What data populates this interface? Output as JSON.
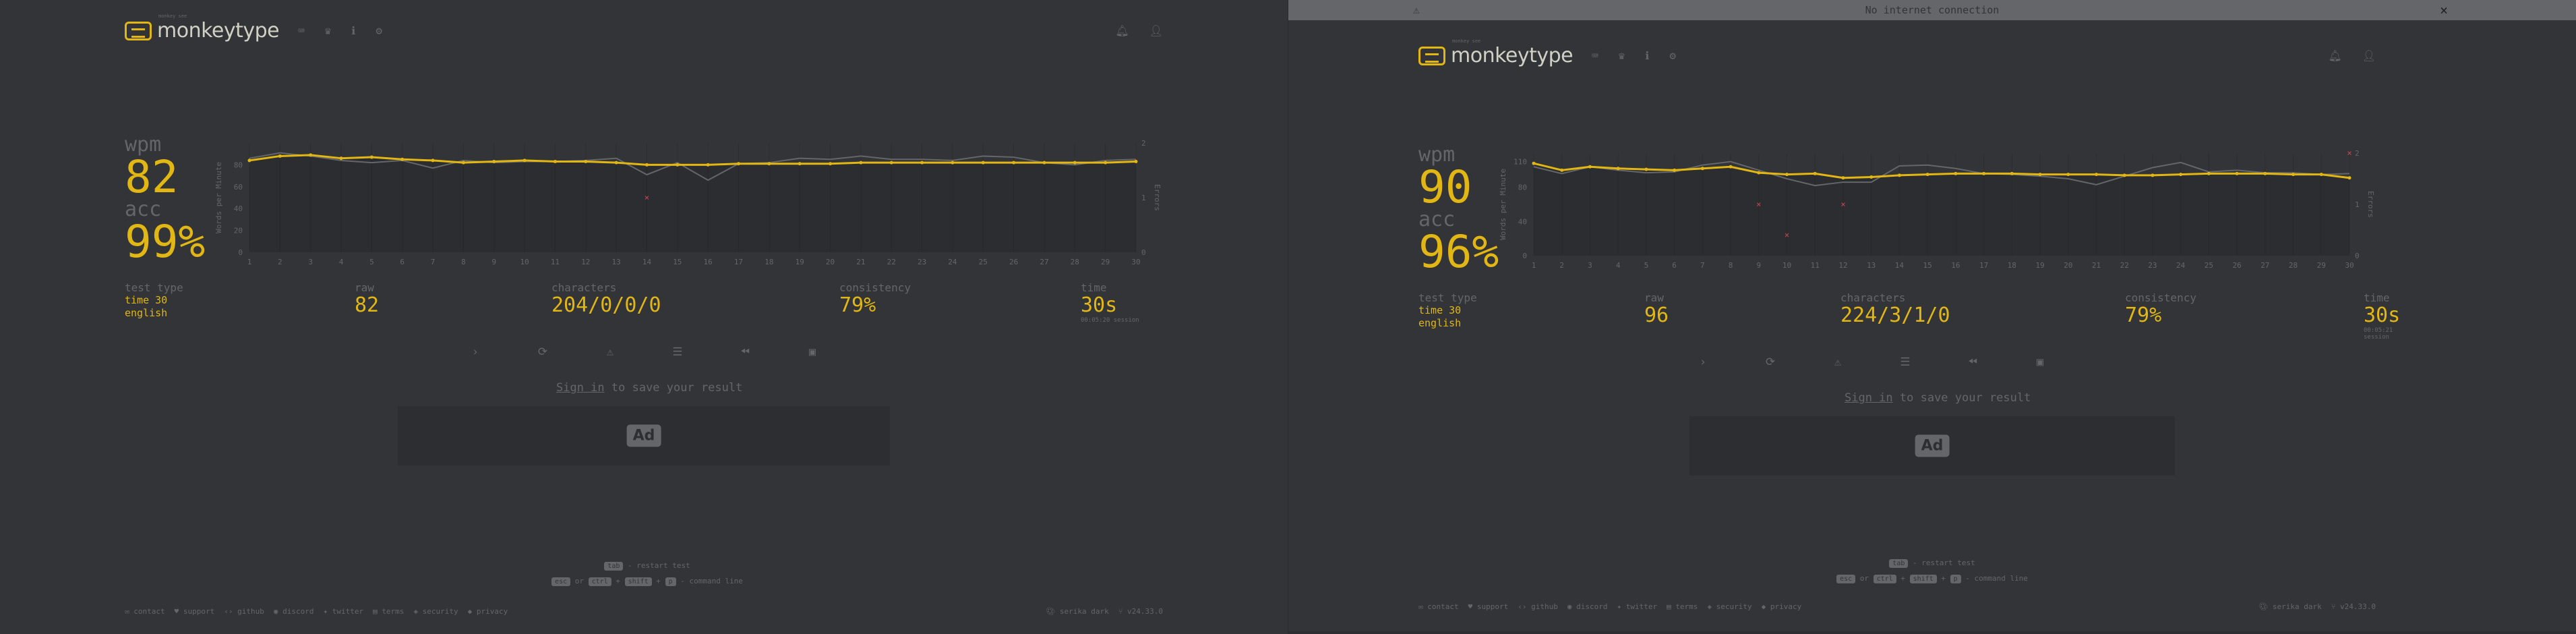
{
  "colors": {
    "bg": "#323437",
    "main": "#e2b714",
    "sub": "#646669",
    "text": "#d1d0c5",
    "error": "#ca4754",
    "subAlt": "#2c2e31"
  },
  "left": {
    "header": {
      "logo_text": "monkeytype",
      "logo_tag": "monkey see"
    },
    "stats": {
      "wpm_label": "wpm",
      "wpm": "82",
      "acc_label": "acc",
      "acc": "99%"
    },
    "info": {
      "test_type_label": "test type",
      "test_type_mode": "time 30",
      "test_type_lang": "english",
      "raw_label": "raw",
      "raw": "82",
      "characters_label": "characters",
      "characters": "204/0/0/0",
      "consistency_label": "consistency",
      "consistency": "79%",
      "time_label": "time",
      "time": "30s",
      "time_sub": "00:05:20 session"
    },
    "signin_link": "Sign in",
    "signin_rest": " to save your result",
    "ad_label": "Ad",
    "keytips": {
      "k1": "tab",
      "t1": " - restart test",
      "k2": "esc",
      "or": " or ",
      "k3": "ctrl",
      "plus": " + ",
      "k4": "shift",
      "k5": "p",
      "t2": " - command line"
    },
    "footer": {
      "links": [
        "contact",
        "support",
        "github",
        "discord",
        "twitter",
        "terms",
        "security",
        "privacy"
      ],
      "theme": "serika dark",
      "version": "v24.33.0"
    },
    "chart_data": {
      "type": "line",
      "x": [
        1,
        2,
        3,
        4,
        5,
        6,
        7,
        8,
        9,
        10,
        11,
        12,
        13,
        14,
        15,
        16,
        17,
        18,
        19,
        20,
        21,
        22,
        23,
        24,
        25,
        26,
        27,
        28,
        29,
        30
      ],
      "y_ticks": [
        "0",
        "20",
        "40",
        "60",
        "80"
      ],
      "errors_ticks": [
        "0",
        "1",
        "2"
      ],
      "ylabel": "Words per Minute",
      "y2label": "Errors",
      "ylim": [
        0,
        100
      ],
      "y2lim": [
        0,
        2
      ],
      "series": [
        {
          "values": [
            84,
            88,
            89,
            86,
            87,
            85,
            84,
            82,
            83,
            84,
            83,
            83,
            82,
            80,
            80,
            80,
            81,
            81,
            81,
            81,
            82,
            82,
            82,
            82,
            82,
            82,
            82,
            82,
            82,
            83
          ]
        },
        {
          "values": [
            86,
            91,
            88,
            84,
            82,
            84,
            77,
            84,
            82,
            83,
            83,
            84,
            86,
            71,
            82,
            66,
            81,
            82,
            86,
            85,
            88,
            85,
            85,
            84,
            88,
            87,
            82,
            80,
            84,
            85
          ]
        }
      ],
      "errors": [
        {
          "x": 14,
          "y": 1
        }
      ]
    }
  },
  "right": {
    "offline_bar": "No internet connection",
    "header": {
      "logo_text": "monkeytype",
      "logo_tag": "monkey see"
    },
    "stats": {
      "wpm_label": "wpm",
      "wpm": "90",
      "acc_label": "acc",
      "acc": "96%"
    },
    "info": {
      "test_type_label": "test type",
      "test_type_mode": "time 30",
      "test_type_lang": "english",
      "raw_label": "raw",
      "raw": "96",
      "characters_label": "characters",
      "characters": "224/3/1/0",
      "consistency_label": "consistency",
      "consistency": "79%",
      "time_label": "time",
      "time": "30s",
      "time_sub": "00:05:21 session"
    },
    "signin_link": "Sign in",
    "signin_rest": " to save your result",
    "ad_label": "Ad",
    "keytips": {
      "k1": "tab",
      "t1": " - restart test",
      "k2": "esc",
      "or": " or ",
      "k3": "ctrl",
      "plus": " + ",
      "k4": "shift",
      "k5": "p",
      "t2": " - command line"
    },
    "footer": {
      "links": [
        "contact",
        "support",
        "github",
        "discord",
        "twitter",
        "terms",
        "security",
        "privacy"
      ],
      "theme": "serika dark",
      "version": "v24.33.0"
    },
    "chart_data": {
      "type": "line",
      "x": [
        1,
        2,
        3,
        4,
        5,
        6,
        7,
        8,
        9,
        10,
        11,
        12,
        13,
        14,
        15,
        16,
        17,
        18,
        19,
        20,
        21,
        22,
        23,
        24,
        25,
        26,
        27,
        28,
        29,
        30
      ],
      "y_ticks": [
        "0",
        "40",
        "80",
        "110"
      ],
      "errors_ticks": [
        "0",
        "1",
        "2"
      ],
      "ylabel": "Words per Minute",
      "y2label": "Errors",
      "ylim": [
        0,
        120
      ],
      "y2lim": [
        0,
        2
      ],
      "series": [
        {
          "values": [
            108,
            100,
            104,
            102,
            101,
            100,
            102,
            104,
            97,
            95,
            96,
            91,
            92,
            94,
            95,
            96,
            96,
            96,
            95,
            95,
            95,
            94,
            94,
            95,
            96,
            96,
            96,
            95,
            95,
            91
          ]
        },
        {
          "values": [
            104,
            96,
            104,
            100,
            97,
            98,
            106,
            110,
            100,
            90,
            82,
            86,
            86,
            105,
            106,
            102,
            96,
            95,
            93,
            90,
            83,
            93,
            103,
            109,
            98,
            100,
            97,
            97,
            95,
            96
          ]
        }
      ],
      "errors": [
        {
          "x": 9,
          "y": 1
        },
        {
          "x": 10,
          "y": 0.4
        },
        {
          "x": 12,
          "y": 1
        },
        {
          "x": 30,
          "y": 2
        }
      ]
    }
  }
}
